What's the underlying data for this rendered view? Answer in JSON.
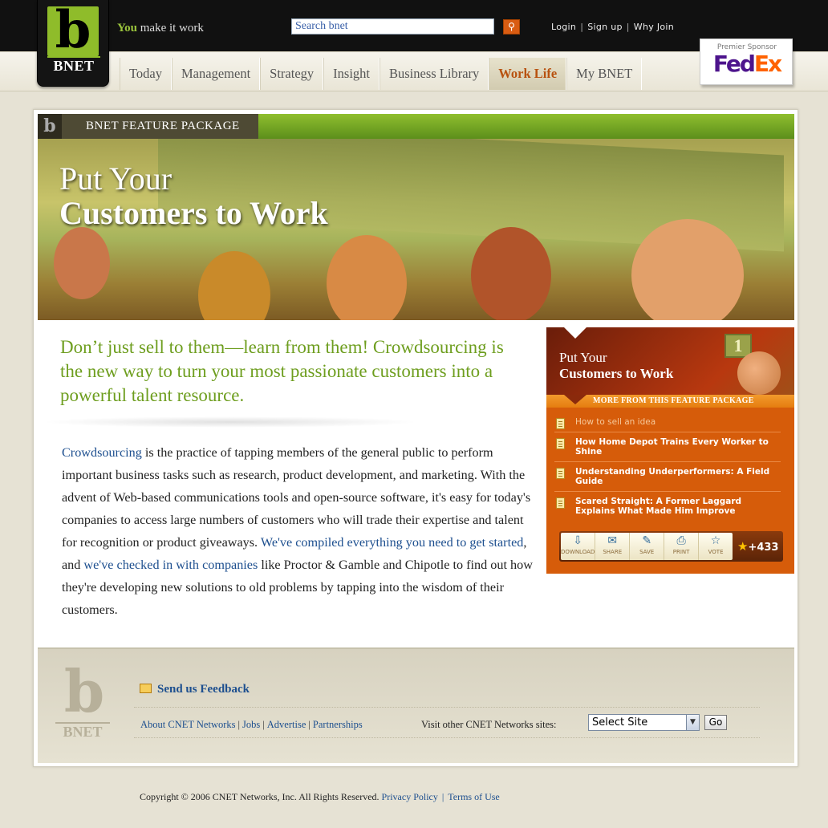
{
  "header": {
    "logo_letter": "b",
    "logo_word": "BNET",
    "tagline_you": "You",
    "tagline_rest": " make it work",
    "search_value": "Search bnet",
    "search_button_icon": "search-icon",
    "links": [
      "Login",
      "Sign up",
      "Why Join"
    ]
  },
  "nav": {
    "items": [
      "Today",
      "Management",
      "Strategy",
      "Insight",
      "Business Library",
      "Work Life",
      "My BNET"
    ],
    "active": "Work Life"
  },
  "sponsor": {
    "label": "Premier Sponsor",
    "brand_fed": "Fed",
    "brand_ex": "Ex",
    "colors": {
      "fed": "#4d148c",
      "ex": "#ff6200"
    }
  },
  "feature": {
    "bar_letter": "b",
    "bar_label": "BNET FEATURE PACKAGE",
    "hero_line1": "Put Your",
    "hero_line2": "Customers to Work",
    "lede": "Don’t just sell to them—learn from them! Crowdsourcing is the new way to turn your most passionate customers into a powerful talent resource.",
    "body": {
      "link1": "Crowdsourcing",
      "text1": " is the practice of tapping members of the general public to perform important business tasks such as research, product development, and marketing. With the advent of Web-based communications tools and open-source software, it's easy for today's companies to access large numbers of customers who will trade their expertise and talent for recognition or product giveaways. ",
      "link2": "We've compiled everything you need to get started",
      "text2": ", and ",
      "link3": "we've checked in with companies",
      "text3": " like Proctor & Gamble and Chipotle to find out how they're developing new solutions to old problems by tapping into the wisdom of their customers."
    }
  },
  "sidebar": {
    "title1": "Put Your",
    "title2": "Customers to Work",
    "bill_label": "1",
    "more_label": "MORE FROM THIS FEATURE PACKAGE",
    "items": [
      "How to sell an idea",
      "How Home Depot Trains Every Worker to Shine",
      "Understanding Underperformers: A Field Guide",
      "Scared Straight: A Former Laggard Explains What Made Him Improve"
    ],
    "tools": [
      "DOWNLOAD",
      "SHARE",
      "SAVE",
      "PRINT",
      "VOTE"
    ],
    "vote_count": "+433",
    "accent": "#d65c0a"
  },
  "footer": {
    "logo_letter": "b",
    "logo_word": "BNET",
    "feedback": "Send us Feedback",
    "links": [
      "About CNET Networks",
      "Jobs",
      "Advertise",
      "Partnerships"
    ],
    "visit_label": "Visit other CNET Networks sites:",
    "select_value": "Select Site",
    "go_label": "Go",
    "copyright": "Copyright © 2006 CNET Networks, Inc. All Rights Reserved.",
    "privacy": "Privacy Policy",
    "terms": "Terms of Use"
  }
}
